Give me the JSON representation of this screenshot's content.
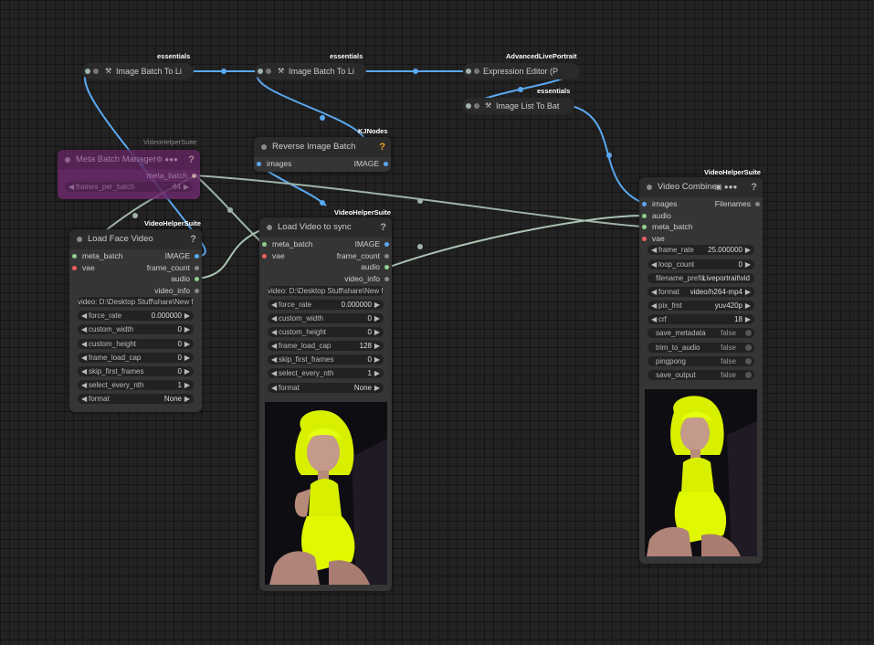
{
  "canvas": {
    "background": "#222222"
  },
  "colors": {
    "image_link": "#5aa8f0",
    "audio_link": "#a9c4b2",
    "meta_link": "#9fb3a7",
    "meta_node": "#7a2a7a"
  },
  "badges": {
    "essentials": "essentials",
    "advanced_live_portrait": "AdvancedLivePortrait",
    "kjnodes": "KJNodes",
    "vhs": "VideoHelperSuite"
  },
  "collapsed_nodes": {
    "batch_to_list_1": "Image Batch To Li",
    "batch_to_list_2": "Image Batch To Li",
    "expression_editor": "Expression Editor (P",
    "list_to_batch": "Image List To Bat"
  },
  "meta_batch_manager": {
    "title": "Meta Batch Manager",
    "icons": "⚙ ●●●",
    "help": "?",
    "output": "meta_batch",
    "widget_label": "frames_per_batch",
    "widget_value": "64"
  },
  "reverse_image_batch": {
    "title": "Reverse Image Batch",
    "help": "?",
    "input": "images",
    "output": "IMAGE"
  },
  "load_face_video": {
    "title": "Load Face Video",
    "help": "?",
    "inputs": [
      "meta_batch",
      "vae"
    ],
    "outputs": [
      "IMAGE",
      "frame_count",
      "audio",
      "video_info"
    ],
    "file": "video: D:\\Desktop Stuff\\share\\New fo",
    "widgets": [
      {
        "label": "force_rate",
        "value": "0.000000"
      },
      {
        "label": "custom_width",
        "value": "0"
      },
      {
        "label": "custom_height",
        "value": "0"
      },
      {
        "label": "frame_load_cap",
        "value": "0"
      },
      {
        "label": "skip_first_frames",
        "value": "0"
      },
      {
        "label": "select_every_nth",
        "value": "1"
      },
      {
        "label": "format",
        "value": "None"
      }
    ]
  },
  "load_video_sync": {
    "title": "Load Video to sync",
    "help": "?",
    "inputs": [
      "meta_batch",
      "vae"
    ],
    "outputs": [
      "IMAGE",
      "frame_count",
      "audio",
      "video_info"
    ],
    "file": "video: D:\\Desktop Stuff\\share\\New fo",
    "widgets": [
      {
        "label": "force_rate",
        "value": "0.000000"
      },
      {
        "label": "custom_width",
        "value": "0"
      },
      {
        "label": "custom_height",
        "value": "0"
      },
      {
        "label": "frame_load_cap",
        "value": "128"
      },
      {
        "label": "skip_first_frames",
        "value": "0"
      },
      {
        "label": "select_every_nth",
        "value": "1"
      },
      {
        "label": "format",
        "value": "None"
      }
    ]
  },
  "video_combine": {
    "title": "Video Combine",
    "icons": "▣ ●●●",
    "help": "?",
    "inputs": [
      "images",
      "audio",
      "meta_batch",
      "vae"
    ],
    "output": "Filenames",
    "widgets": [
      {
        "label": "frame_rate",
        "value": "25.000000"
      },
      {
        "label": "loop_count",
        "value": "0"
      },
      {
        "label": "filename_prefix",
        "value": "Liveportrait\\vid"
      },
      {
        "label": "format",
        "value": "video/h264-mp4"
      },
      {
        "label": "pix_fmt",
        "value": "yuv420p"
      },
      {
        "label": "crf",
        "value": "18"
      }
    ],
    "toggles": [
      {
        "label": "save_metadata",
        "value": "false"
      },
      {
        "label": "trim_to_audio",
        "value": "false"
      },
      {
        "label": "pingpong",
        "value": "false"
      },
      {
        "label": "save_output",
        "value": "false"
      }
    ]
  }
}
